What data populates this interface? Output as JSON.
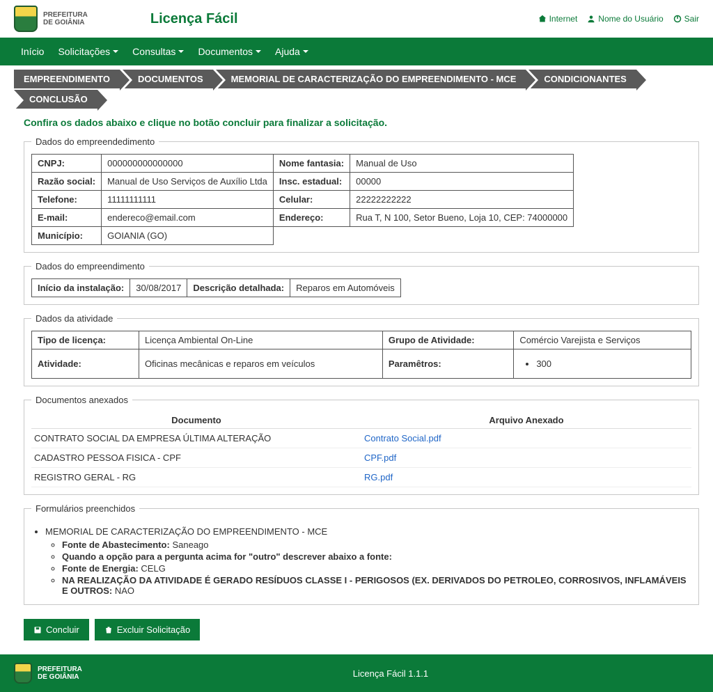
{
  "brand": {
    "line1": "PREFEITURA",
    "line2": "DE GOIÂNIA"
  },
  "app_title": "Licença Fácil",
  "header_links": {
    "internet": "Internet",
    "user": "Nome do Usuário",
    "logout": "Sair"
  },
  "nav": {
    "inicio": "Início",
    "solicitacoes": "Solicitações",
    "consultas": "Consultas",
    "documentos": "Documentos",
    "ajuda": "Ajuda"
  },
  "crumbs": [
    "EMPREENDIMENTO",
    "DOCUMENTOS",
    "MEMORIAL DE CARACTERIZAÇÃO DO EMPREENDIMENTO - MCE",
    "CONDICIONANTES",
    "CONCLUSÃO"
  ],
  "instruction": "Confira os dados abaixo e clique no botão concluir para finalizar a solicitação.",
  "set1": {
    "legend": "Dados do empreendedimento",
    "labels": {
      "cnpj": "CNPJ:",
      "nome_fantasia": "Nome fantasia:",
      "razao": "Razão social:",
      "insc": "Insc. estadual:",
      "telefone": "Telefone:",
      "celular": "Celular:",
      "email": "E-mail:",
      "endereco": "Endereço:",
      "municipio": "Município:"
    },
    "values": {
      "cnpj": "000000000000000",
      "nome_fantasia": "Manual de Uso",
      "razao": "Manual de Uso Serviços de Auxílio Ltda",
      "insc": "00000",
      "telefone": "11111111111",
      "celular": "22222222222",
      "email": "endereco@email.com",
      "endereco": "Rua T, N 100, Setor Bueno, Loja 10, CEP: 74000000",
      "municipio": "GOIANIA (GO)"
    }
  },
  "set2": {
    "legend": "Dados do empreendimento",
    "labels": {
      "inicio": "Início da instalação:",
      "descricao": "Descrição detalhada:"
    },
    "values": {
      "inicio": "30/08/2017",
      "descricao": "Reparos em Automóveis"
    }
  },
  "set3": {
    "legend": "Dados da atividade",
    "labels": {
      "tipo": "Tipo de licença:",
      "grupo": "Grupo de Atividade:",
      "atividade": "Atividade:",
      "param": "Paramêtros:"
    },
    "values": {
      "tipo": "Licença Ambiental On-Line",
      "grupo": "Comércio Varejista e Serviços",
      "atividade": "Oficinas mecânicas e reparos em veículos",
      "param": "300"
    }
  },
  "docs": {
    "legend": "Documentos anexados",
    "headers": {
      "doc": "Documento",
      "file": "Arquivo Anexado"
    },
    "rows": [
      {
        "doc": "CONTRATO SOCIAL DA EMPRESA ÚLTIMA ALTERAÇÃO",
        "file": "Contrato Social.pdf"
      },
      {
        "doc": "CADASTRO PESSOA FISICA - CPF",
        "file": "CPF.pdf"
      },
      {
        "doc": "REGISTRO GERAL - RG",
        "file": "RG.pdf"
      }
    ]
  },
  "forms": {
    "legend": "Formulários preenchidos",
    "title": "MEMORIAL DE CARACTERIZAÇÃO DO EMPREENDIMENTO - MCE",
    "items": [
      {
        "label": "Fonte de Abastecimento:",
        "value": "Saneago"
      },
      {
        "label": "Quando a opção para a pergunta acima for \"outro\" descrever abaixo a fonte:",
        "value": ""
      },
      {
        "label": "Fonte de Energia:",
        "value": "CELG"
      },
      {
        "label": "NA REALIZAÇÃO DA ATIVIDADE É GERADO RESÍDUOS CLASSE I - PERIGOSOS (EX. DERIVADOS DO PETROLEO, CORROSIVOS, INFLAMÁVEIS E OUTROS:",
        "value": "NAO"
      }
    ]
  },
  "buttons": {
    "concluir": "Concluir",
    "excluir": "Excluir Solicitação"
  },
  "footer": "Licença Fácil 1.1.1"
}
